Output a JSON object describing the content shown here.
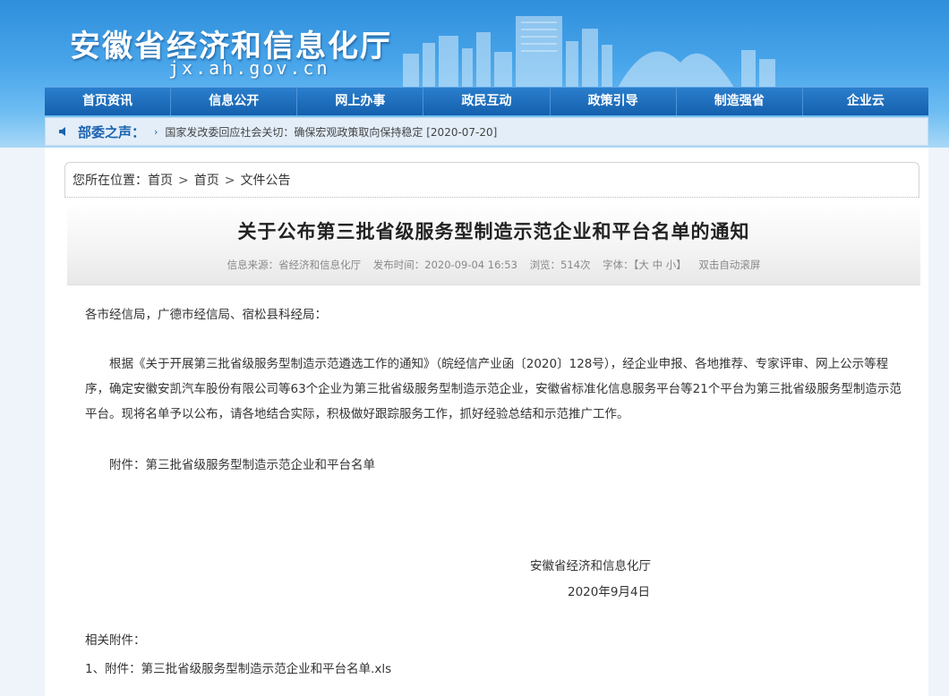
{
  "header": {
    "title": "安徽省经济和信息化厅",
    "domain": "jx.ah.gov.cn"
  },
  "nav": {
    "items": [
      "首页资讯",
      "信息公开",
      "网上办事",
      "政民互动",
      "政策引导",
      "制造强省",
      "企业云"
    ]
  },
  "notice": {
    "label": "部委之声：",
    "arrow": "›",
    "text": "国家发改委回应社会关切：确保宏观政策取向保持稳定 [2020-07-20]"
  },
  "breadcrumb": {
    "prefix": "您所在位置：",
    "items": [
      "首页",
      "首页",
      "文件公告"
    ],
    "separator": ">"
  },
  "article": {
    "title": "关于公布第三批省级服务型制造示范企业和平台名单的通知",
    "meta": {
      "source": "信息来源：省经济和信息化厅",
      "time": "发布时间：2020-09-04 16:53",
      "views": "浏览：514次",
      "font_label": "字体：",
      "font_options": "【大 中 小】",
      "scroll": "双击自动滚屏"
    },
    "salutation": "各市经信局，广德市经信局、宿松县科经局：",
    "paragraph1": "根据《关于开展第三批省级服务型制造示范遴选工作的通知》（皖经信产业函〔2020〕128号），经企业申报、各地推荐、专家评审、网上公示等程序，确定安徽安凯汽车股份有限公司等63个企业为第三批省级服务型制造示范企业，安徽省标准化信息服务平台等21个平台为第三批省级服务型制造示范平台。现将名单予以公布，请各地结合实际，积极做好跟踪服务工作，抓好经验总结和示范推广工作。",
    "attachment_line": "附件：第三批省级服务型制造示范企业和平台名单",
    "signature_org": "安徽省经济和信息化厅",
    "signature_date": "2020年9月4日",
    "related_label": "相关附件：",
    "related_item": "1、附件：第三批省级服务型制造示范企业和平台名单.xls"
  },
  "colors": {
    "header_blue": "#2f8fdc",
    "nav_blue": "#1460ad",
    "notice_label": "#1c63ae",
    "page_bg": "#eef4fa"
  }
}
